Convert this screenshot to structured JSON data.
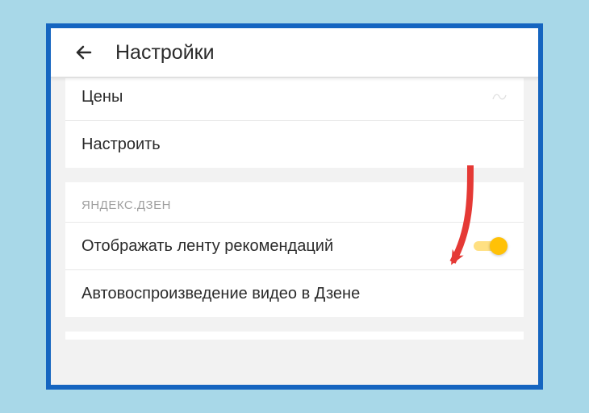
{
  "header": {
    "title": "Настройки"
  },
  "group1": {
    "rows": [
      {
        "label": "Цены"
      },
      {
        "label": "Настроить"
      }
    ]
  },
  "group2": {
    "section": "ЯНДЕКС.ДЗЕН",
    "rows": [
      {
        "label": "Отображать ленту рекомендаций",
        "toggle": true
      },
      {
        "label": "Автовоспроизведение видео в Дзене"
      }
    ]
  },
  "colors": {
    "toggle_on": "#ffc107",
    "frame_border": "#1565c0",
    "arrow": "#e53935"
  }
}
